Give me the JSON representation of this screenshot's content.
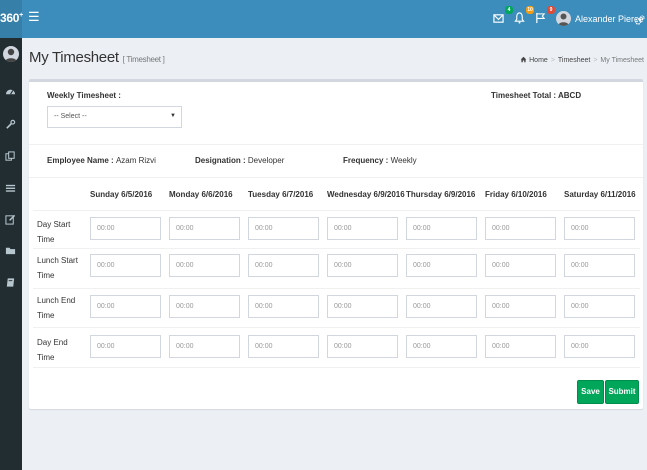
{
  "app": {
    "logo": "360",
    "logo_sup": "+"
  },
  "topbar": {
    "badges": {
      "messages": "4",
      "notifications": "10",
      "tasks": "9"
    },
    "user_name": "Alexander Pierce"
  },
  "page": {
    "title": "My Timesheet",
    "subtitle": "[ Timesheet ]"
  },
  "breadcrumb": {
    "home": "Home",
    "parent": "Timesheet",
    "current": "My Timesheet"
  },
  "form": {
    "weekly_label": "Weekly Timesheet :",
    "select_value": "-- Select --",
    "total_label": "Timesheet Total :",
    "total_value": "ABCD",
    "employee_label": "Employee Name :",
    "employee_value": "Azam Rizvi",
    "designation_label": "Designation :",
    "designation_value": "Developer",
    "frequency_label": "Frequency :",
    "frequency_value": "Weekly"
  },
  "table": {
    "columns": [
      "Sunday 6/5/2016",
      "Monday 6/6/2016",
      "Tuesday 6/7/2016",
      "Wednesday 6/9/2016",
      "Thursday 6/9/2016",
      "Friday 6/10/2016",
      "Saturday 6/11/2016"
    ],
    "rows": [
      "Day Start Time",
      "Lunch Start Time",
      "Lunch End Time",
      "Day End Time"
    ],
    "placeholder": "00:00"
  },
  "actions": {
    "save": "Save",
    "submit": "Submit"
  },
  "colors": {
    "header": "#3c8dbc",
    "sidebar": "#222d32",
    "success": "#00a65a"
  }
}
